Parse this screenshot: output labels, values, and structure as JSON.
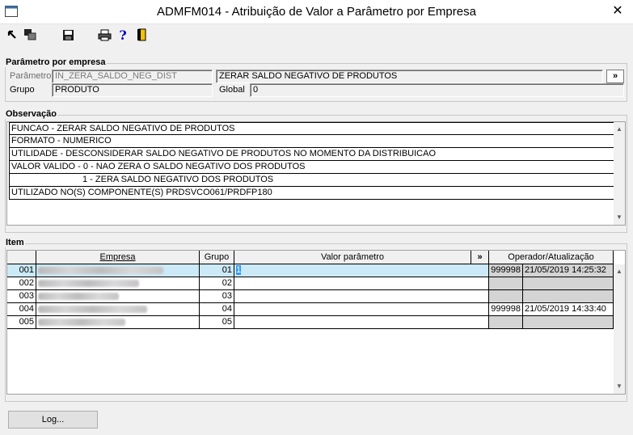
{
  "window": {
    "title": "ADMFM014 - Atribuição de Valor a Parâmetro por Empresa",
    "close_glyph": "✕"
  },
  "toolbar": {
    "icons": [
      "navigate-icon",
      "windows-icon",
      "save-icon",
      "print-icon",
      "help-icon",
      "exit-icon"
    ]
  },
  "parametro_group": {
    "title": "Parâmetro por empresa",
    "parametro_label": "Parâmetro",
    "parametro_value": "IN_ZERA_SALDO_NEG_DIST",
    "descricao_value": "ZERAR SALDO NEGATIVO DE PRODUTOS",
    "expand_label": "»",
    "grupo_label": "Grupo",
    "grupo_value": "PRODUTO",
    "global_label": "Global",
    "global_value": "0"
  },
  "observacao": {
    "title": "Observação",
    "lines": [
      "FUNCAO - ZERAR SALDO NEGATIVO DE PRODUTOS",
      "FORMATO - NUMERICO",
      "UTILIDADE - DESCONSIDERAR SALDO NEGATIVO DE PRODUTOS NO MOMENTO DA DISTRIBUICAO",
      "VALOR VALIDO - 0 - NAO ZERA O SALDO NEGATIVO DOS PRODUTOS",
      "1 - ZERA SALDO NEGATIVO DOS PRODUTOS",
      "UTILIZADO NO(S) COMPONENTE(S) PRDSVCO061/PRDFP180"
    ]
  },
  "item": {
    "title": "Item",
    "headers": {
      "empresa": "Empresa",
      "grupo": "Grupo",
      "valor": "Valor parâmetro",
      "expand": "»",
      "operador": "Operador/Atualização"
    },
    "rows": [
      {
        "code": "001",
        "grupo": "01",
        "valor": "1",
        "operador": "999998",
        "data": "21/05/2019 14:25:32"
      },
      {
        "code": "002",
        "grupo": "02",
        "valor": "",
        "operador": "",
        "data": ""
      },
      {
        "code": "003",
        "grupo": "03",
        "valor": "",
        "operador": "",
        "data": ""
      },
      {
        "code": "004",
        "grupo": "04",
        "valor": "",
        "operador": "999998",
        "data": "21/05/2019 14:33:40"
      },
      {
        "code": "005",
        "grupo": "05",
        "valor": "",
        "operador": "",
        "data": ""
      }
    ]
  },
  "log_button": "Log...",
  "colors": {
    "selected_row": "#cbe9f6",
    "readonly_cell": "#d4d4d4"
  }
}
